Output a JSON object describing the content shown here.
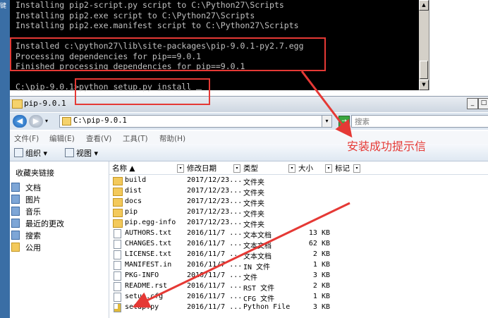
{
  "desktop": {
    "label": "键"
  },
  "console": {
    "lines_top": [
      "Installing pip2-script.py script to C:\\Python27\\Scripts",
      "Installing pip2.exe script to C:\\Python27\\Scripts",
      "Installing pip2.exe.manifest script to C:\\Python27\\Scripts"
    ],
    "lines_mid": [
      "Installed c:\\python27\\lib\\site-packages\\pip-9.0.1-py2.7.egg",
      "Processing dependencies for pip==9.0.1",
      "Finished processing dependencies for pip==9.0.1"
    ],
    "prompt": "C:\\pip-9.0.1>",
    "command": "python setup.py install"
  },
  "explorer": {
    "title": "pip-9.0.1",
    "address": "C:\\pip-9.0.1",
    "search_placeholder": "搜索",
    "menu": [
      "文件(F)",
      "编辑(E)",
      "查看(V)",
      "工具(T)",
      "帮助(H)"
    ],
    "toolbar": {
      "organize": "组织",
      "views": "视图"
    },
    "nav": {
      "heading": "收藏夹链接",
      "items": [
        "文档",
        "图片",
        "音乐",
        "最近的更改",
        "搜索",
        "公用"
      ]
    },
    "columns": {
      "name": "名称",
      "date": "修改日期",
      "type": "类型",
      "size": "大小",
      "tags": "标记"
    },
    "files": [
      {
        "name": "build",
        "date": "2017/12/23...",
        "type": "文件夹",
        "size": "",
        "kind": "folder"
      },
      {
        "name": "dist",
        "date": "2017/12/23...",
        "type": "文件夹",
        "size": "",
        "kind": "folder"
      },
      {
        "name": "docs",
        "date": "2017/12/23...",
        "type": "文件夹",
        "size": "",
        "kind": "folder"
      },
      {
        "name": "pip",
        "date": "2017/12/23...",
        "type": "文件夹",
        "size": "",
        "kind": "folder"
      },
      {
        "name": "pip.egg-info",
        "date": "2017/12/23...",
        "type": "文件夹",
        "size": "",
        "kind": "folder"
      },
      {
        "name": "AUTHORS.txt",
        "date": "2016/11/7 ...",
        "type": "文本文档",
        "size": "13 KB",
        "kind": "file"
      },
      {
        "name": "CHANGES.txt",
        "date": "2016/11/7 ...",
        "type": "文本文档",
        "size": "62 KB",
        "kind": "file"
      },
      {
        "name": "LICENSE.txt",
        "date": "2016/11/7 ...",
        "type": "文本文档",
        "size": "2 KB",
        "kind": "file"
      },
      {
        "name": "MANIFEST.in",
        "date": "2016/11/7 ...",
        "type": "IN 文件",
        "size": "1 KB",
        "kind": "file"
      },
      {
        "name": "PKG-INFO",
        "date": "2016/11/7 ...",
        "type": "文件",
        "size": "3 KB",
        "kind": "file"
      },
      {
        "name": "README.rst",
        "date": "2016/11/7 ...",
        "type": "RST 文件",
        "size": "2 KB",
        "kind": "file"
      },
      {
        "name": "setup.cfg",
        "date": "2016/11/7 ...",
        "type": "CFG 文件",
        "size": "1 KB",
        "kind": "file"
      },
      {
        "name": "setup.py",
        "date": "2016/11/7 ...",
        "type": "Python File",
        "size": "3 KB",
        "kind": "py"
      }
    ]
  },
  "annotation": {
    "text": "安装成功提示信",
    "color": "#e53935"
  }
}
